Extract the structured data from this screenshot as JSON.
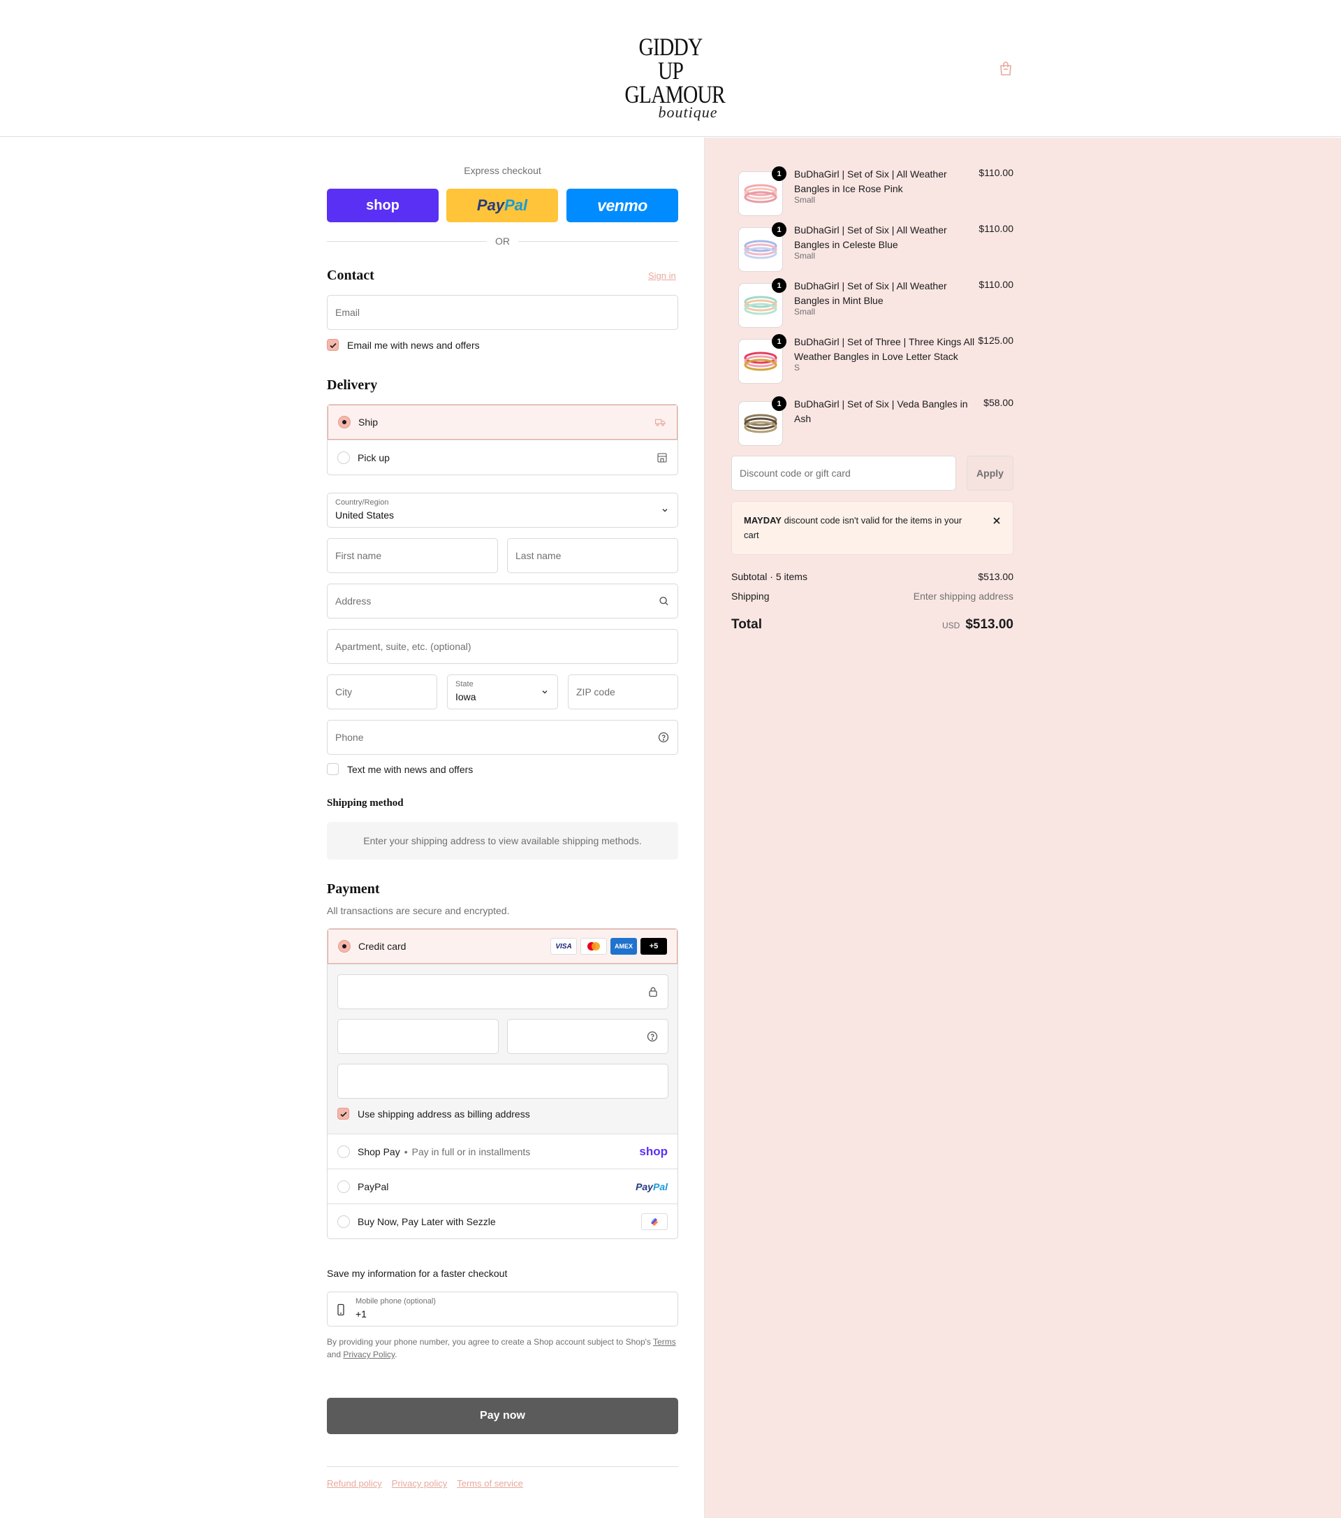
{
  "header": {
    "logo_line1": "GIDDY UP",
    "logo_line2": "GLAMOUR",
    "logo_line3": "boutique"
  },
  "express": {
    "title": "Express checkout",
    "shop_label": "shop",
    "paypal_label_a": "Pay",
    "paypal_label_b": "Pal",
    "venmo_label": "venmo",
    "or_label": "OR"
  },
  "contact": {
    "heading": "Contact",
    "sign_in": "Sign in",
    "email_placeholder": "Email",
    "news_label": "Email me with news and offers",
    "news_checked": true
  },
  "delivery": {
    "heading": "Delivery",
    "options": [
      {
        "label": "Ship",
        "selected": true,
        "icon": "truck-icon"
      },
      {
        "label": "Pick up",
        "selected": false,
        "icon": "store-icon"
      }
    ],
    "country_label": "Country/Region",
    "country_value": "United States",
    "first_name": "First name",
    "last_name": "Last name",
    "address": "Address",
    "apartment": "Apartment, suite, etc. (optional)",
    "city": "City",
    "state_label": "State",
    "state_value": "Iowa",
    "zip": "ZIP code",
    "phone": "Phone",
    "text_label": "Text me with news and offers",
    "text_checked": false
  },
  "shipping_method": {
    "heading": "Shipping method",
    "info": "Enter your shipping address to view available shipping methods."
  },
  "payment": {
    "heading": "Payment",
    "subtext": "All transactions are secure and encrypted.",
    "credit_card_label": "Credit card",
    "card_brands": [
      "VISA",
      "mastercard",
      "AMEX",
      "+5"
    ],
    "billing_same_label": "Use shipping address as billing address",
    "shop_pay_label": "Shop Pay",
    "shop_pay_sub": "Pay in full or in installments",
    "shop_pay_logo": "shop",
    "paypal_label": "PayPal",
    "paypal_logo_a": "Pay",
    "paypal_logo_b": "Pal",
    "sezzle_label": "Buy Now, Pay Later with Sezzle"
  },
  "save_info": {
    "heading": "Save my information for a faster checkout",
    "mobile_label": "Mobile phone (optional)",
    "mobile_value": "+1",
    "legal_prefix": "By providing your phone number, you agree to create a Shop account subject to Shop's ",
    "terms_link": "Terms",
    "legal_and": " and ",
    "privacy_link": "Privacy Policy",
    "legal_suffix": "."
  },
  "pay_now": "Pay now",
  "footer": {
    "refund": "Refund policy",
    "privacy": "Privacy policy",
    "terms": "Terms of service"
  },
  "cart": {
    "items": [
      {
        "name": "BuDhaGirl | Set of Six | All Weather Bangles in Ice Rose Pink",
        "variant": "Small",
        "price": "$110.00",
        "qty": "1",
        "colors": [
          "#f4a7b2",
          "#f7c5b8",
          "#e89aa7"
        ]
      },
      {
        "name": "BuDhaGirl | Set of Six | All Weather Bangles in Celeste Blue",
        "variant": "Small",
        "price": "$110.00",
        "qty": "1",
        "colors": [
          "#a7b8e6",
          "#f1b7c9",
          "#c5d2ef"
        ]
      },
      {
        "name": "BuDhaGirl | Set of Six | All Weather Bangles in Mint Blue",
        "variant": "Small",
        "price": "$110.00",
        "qty": "1",
        "colors": [
          "#9fd9c8",
          "#f3c8a2",
          "#b6e3d6"
        ]
      },
      {
        "name": "BuDhaGirl | Set of Three | Three Kings All Weather Bangles in Love Letter Stack",
        "variant": "S",
        "price": "$125.00",
        "qty": "1",
        "colors": [
          "#e23f5d",
          "#f2a0b0",
          "#d4a437"
        ]
      },
      {
        "name": "BuDhaGirl | Set of Six | Veda Bangles in Ash",
        "variant": "",
        "price": "$58.00",
        "qty": "1",
        "colors": [
          "#8c7a5c",
          "#5c4e3b",
          "#b39d72"
        ]
      }
    ],
    "discount_placeholder": "Discount code or gift card",
    "apply_label": "Apply",
    "alert_code": "MAYDAY",
    "alert_text": " discount code isn't valid for the items in your cart",
    "subtotal_label": "Subtotal · 5 items",
    "subtotal_value": "$513.00",
    "shipping_label": "Shipping",
    "shipping_value": "Enter shipping address",
    "total_label": "Total",
    "currency": "USD",
    "total_value": "$513.00"
  },
  "colors": {
    "accent": "#e8a89b",
    "summary_bg": "#f9e6e3",
    "pay_button": "#5b5b5b"
  }
}
